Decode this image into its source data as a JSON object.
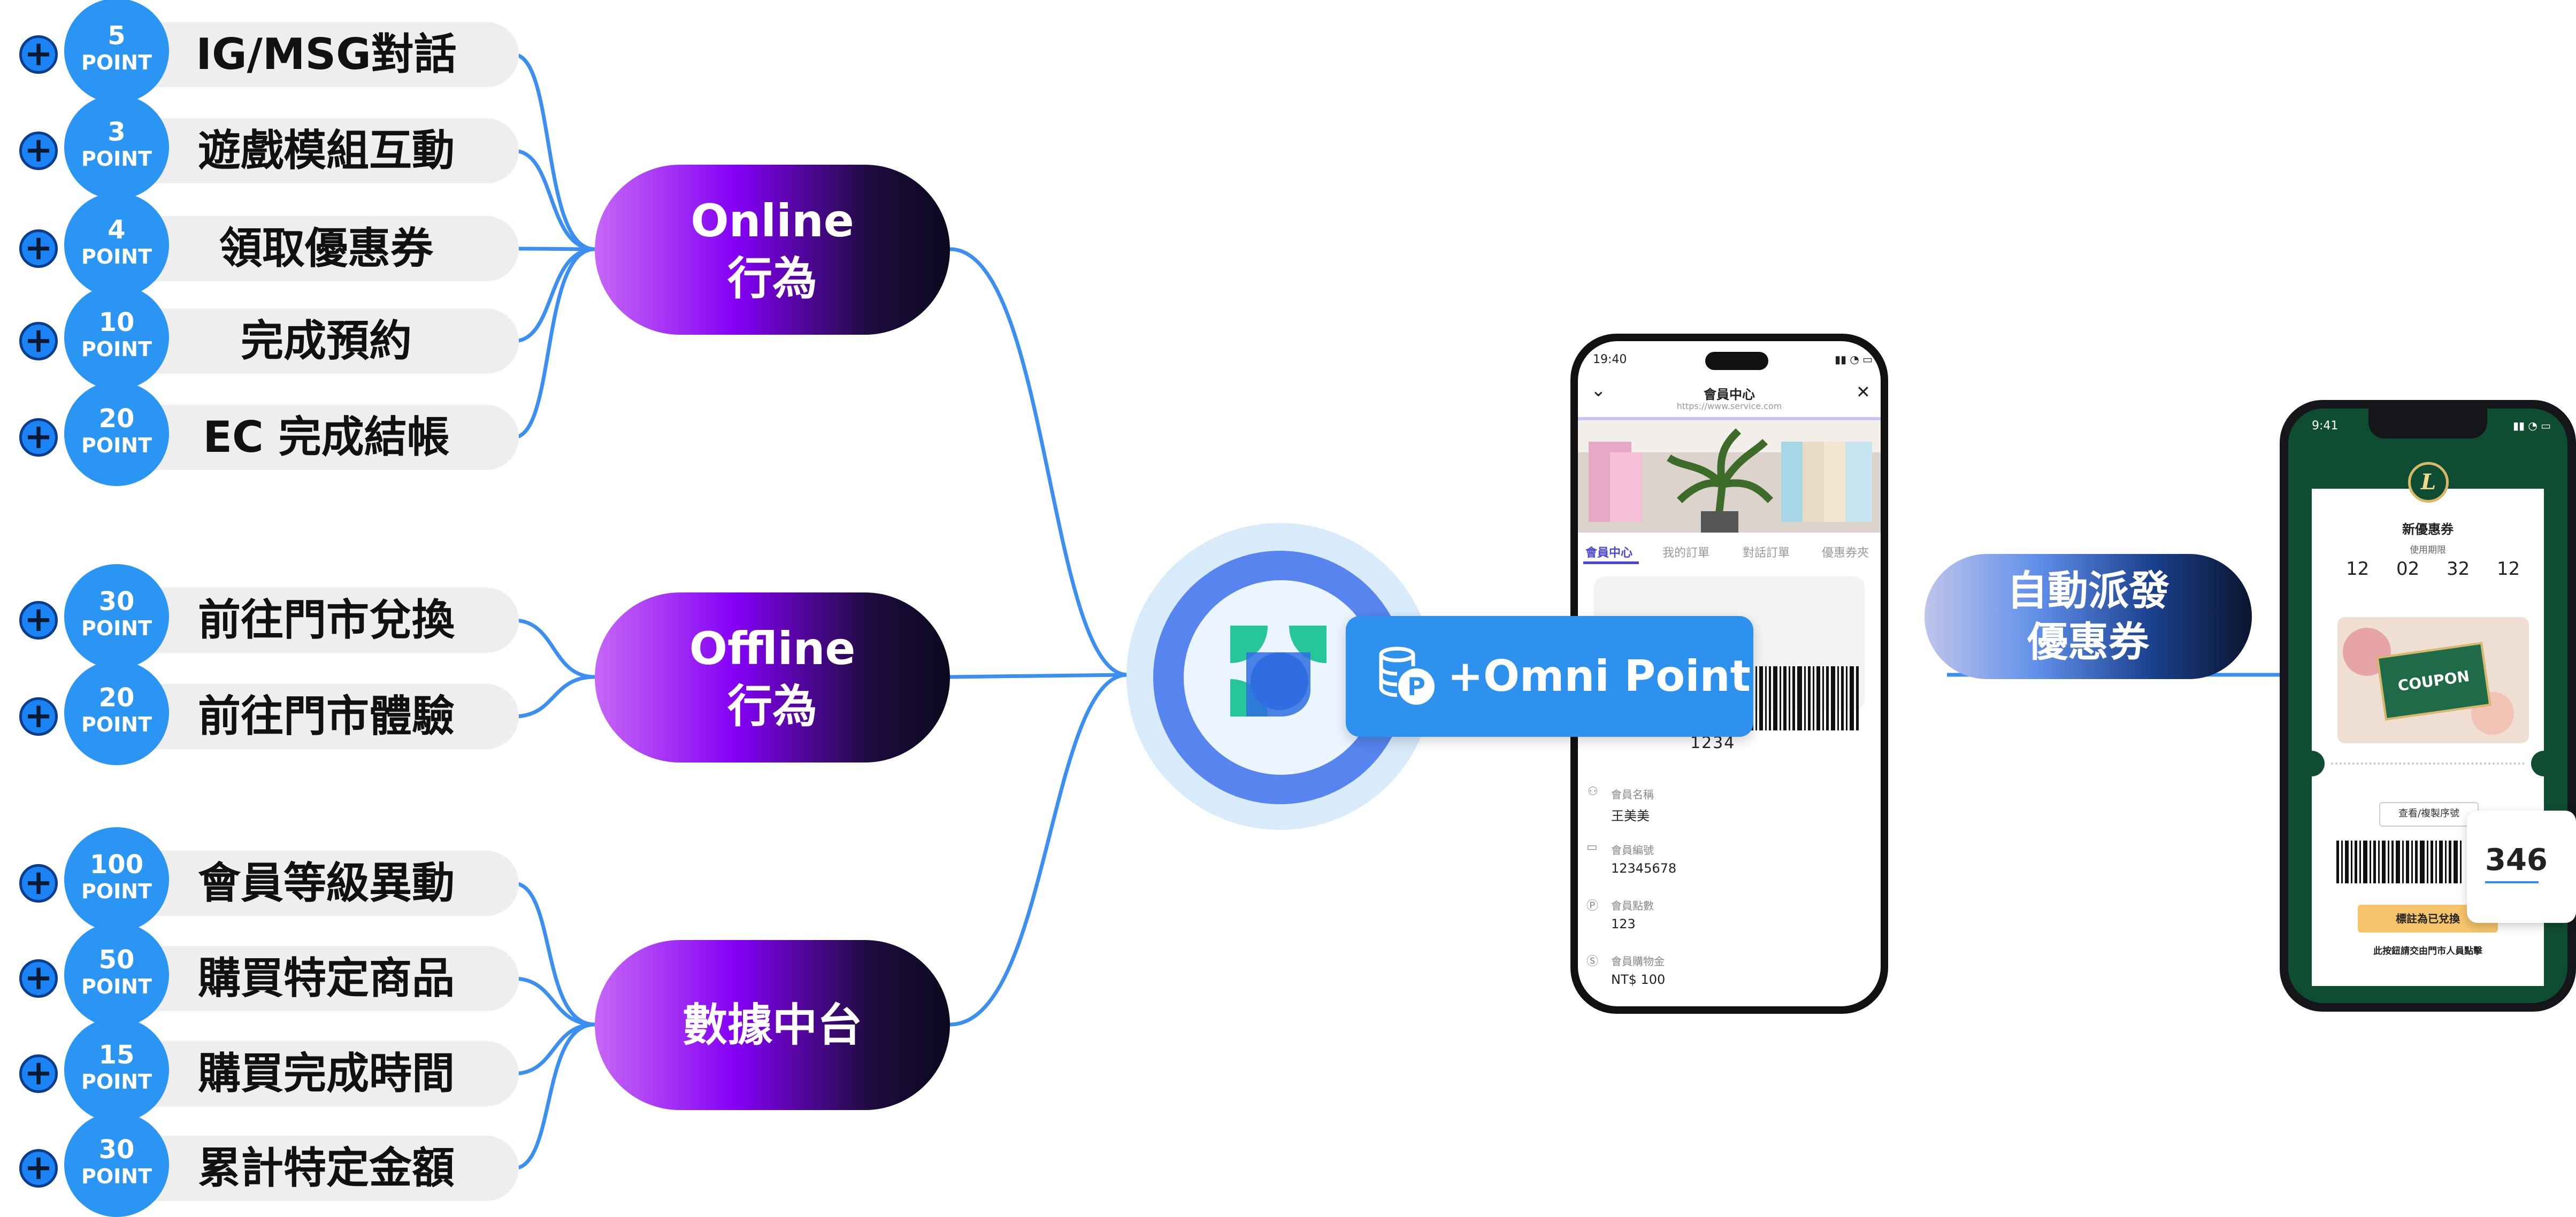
{
  "online_items": [
    {
      "points": "5",
      "unit": "POINT",
      "label": "IG/MSG對話"
    },
    {
      "points": "3",
      "unit": "POINT",
      "label": "遊戲模組互動"
    },
    {
      "points": "4",
      "unit": "POINT",
      "label": "領取優惠券"
    },
    {
      "points": "10",
      "unit": "POINT",
      "label": "完成預約"
    },
    {
      "points": "20",
      "unit": "POINT",
      "label": "EC 完成結帳"
    }
  ],
  "offline_items": [
    {
      "points": "30",
      "unit": "POINT",
      "label": "前往門市兌換"
    },
    {
      "points": "20",
      "unit": "POINT",
      "label": "前往門市體驗"
    }
  ],
  "data_items": [
    {
      "points": "100",
      "unit": "POINT",
      "label": "會員等級異動"
    },
    {
      "points": "50",
      "unit": "POINT",
      "label": "購買特定商品"
    },
    {
      "points": "15",
      "unit": "POINT",
      "label": "購買完成時間"
    },
    {
      "points": "30",
      "unit": "POINT",
      "label": "累計特定金額"
    }
  ],
  "plus_symbol": "+",
  "categories": {
    "online": {
      "line1": "Online",
      "line2": "行為"
    },
    "offline": {
      "line1": "Offline",
      "line2": "行為"
    },
    "data": {
      "line1": "數據中台"
    }
  },
  "omni_button": {
    "label": "+Omni Point"
  },
  "member_phone": {
    "time": "19:40",
    "title": "會員中心",
    "url": "https://www.service.com",
    "tabs": [
      "會員中心",
      "我的訂單",
      "對話訂單",
      "優惠券夾"
    ],
    "barcode_number": "1234",
    "fields": [
      {
        "label": "會員名稱",
        "value": "王美美"
      },
      {
        "label": "會員編號",
        "value": "12345678"
      },
      {
        "label": "會員點數",
        "value": "123"
      },
      {
        "label": "會員購物金",
        "value": "NT$ 100"
      }
    ]
  },
  "coupon_pill": {
    "line1": "自動派發",
    "line2": "優惠券"
  },
  "coupon_phone": {
    "time": "9:41",
    "logo_letter": "L",
    "title": "新優惠券",
    "validity_label": "使用期限",
    "countdown": [
      "12",
      "02",
      "32",
      "12"
    ],
    "coupon_badge": "COUPON",
    "view_serial_button": "查看/複製序號",
    "redeem_button": "標註為已兌換",
    "note": "此按鈕請交由門市人員點擊",
    "side_number": "346"
  },
  "colors": {
    "accent_blue": "#2b95f4",
    "connector": "#3b8ff0",
    "purple": "#8400f5",
    "coupon_green": "#0f4d33"
  }
}
